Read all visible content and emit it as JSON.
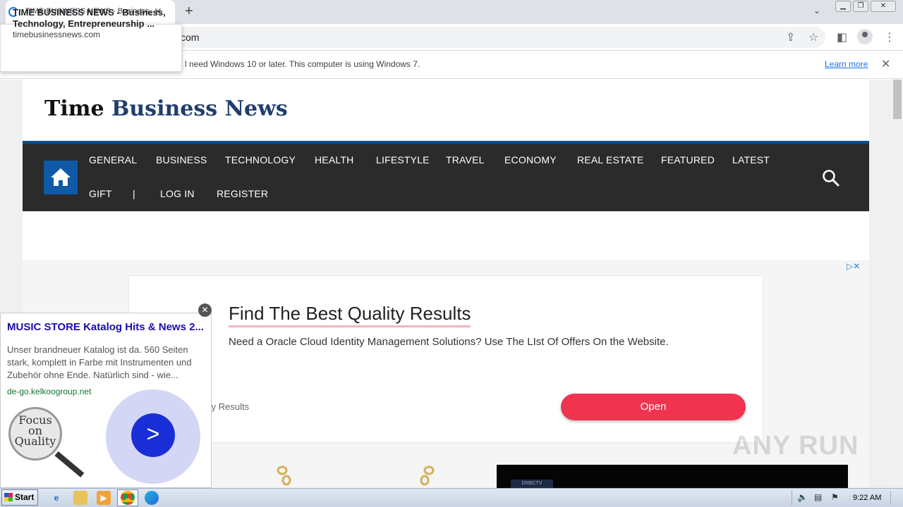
{
  "browser": {
    "tab_title": "TIME BUSINESS NEWS - Business, Te",
    "tab_hover_title": "TIME BUSINESS NEWS - Business, Technology, Entrepreneurship ...",
    "tab_hover_domain": "timebusinessnews.com",
    "url_fragment": "com",
    "new_tab_glyph": "+",
    "close_glyph": "✕",
    "dropdown_glyph": "⌄",
    "infobar_text": "l need Windows 10 or later. This computer is using Windows 7.",
    "learn_more": "Learn more"
  },
  "site": {
    "logo_part1": "Time",
    "logo_part2": "Business News",
    "nav_row1": [
      "GENERAL",
      "BUSINESS",
      "TECHNOLOGY",
      "HEALTH",
      "LIFESTYLE",
      "TRAVEL",
      "ECONOMY",
      "REAL ESTATE",
      "FEATURED",
      "LATEST"
    ],
    "nav_row2": [
      "GIFT",
      "|",
      "LOG IN",
      "REGISTER"
    ]
  },
  "ad": {
    "title": "Find The Best Quality Results",
    "description": "Need a Oracle Cloud Identity Management Solutions? Use The LIst Of Offers On the Website.",
    "source": "ty Results",
    "button": "Open",
    "adchoice": "▷✕"
  },
  "float_ad": {
    "title": "MUSIC STORE Katalog Hits & News 2...",
    "description": "Unser brandneuer Katalog ist da. 560 Seiten stark, komplett in Farbe mit Instrumenten und Zubehör ohne Ende. Natürlich sind - wie...",
    "domain": "de-go.kelkoogroup.net",
    "lens_text": "Focus on Quality",
    "close": "✕",
    "arrow": ">"
  },
  "bottom_label": "DNBCTV",
  "watermark": "ANY RUN",
  "taskbar": {
    "start": "Start",
    "time": "9:22 AM"
  },
  "colors": {
    "nav_bg": "#2b2b2b",
    "nav_border": "#0a4d8c",
    "home_btn": "#0e5aa7",
    "ad_button": "#f0344f",
    "link_blue": "#1a73e8"
  }
}
